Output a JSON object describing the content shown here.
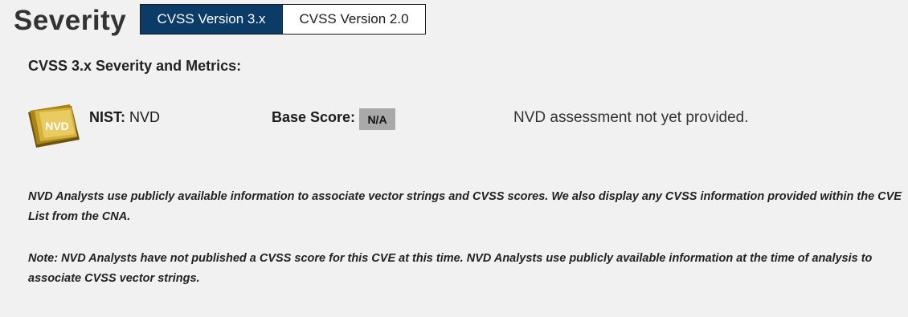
{
  "header": {
    "title": "Severity",
    "tabs": [
      {
        "label": "CVSS Version 3.x",
        "active": true
      },
      {
        "label": "CVSS Version 2.0",
        "active": false
      }
    ]
  },
  "section": {
    "heading": "CVSS 3.x Severity and Metrics:",
    "badge_text": "NVD",
    "source_label": "NIST:",
    "source_value": "NVD",
    "base_score_label": "Base Score:",
    "base_score_value": "N/A",
    "assessment": "NVD assessment not yet provided."
  },
  "notes": [
    "NVD Analysts use publicly available information to associate vector strings and CVSS scores. We also display any CVSS information provided within the CVE List from the CNA.",
    "Note: NVD Analysts have not published a CVSS score for this CVE at this time. NVD Analysts use publicly available information at the time of analysis to associate CVSS vector strings."
  ],
  "colors": {
    "active_tab_bg": "#0b3b67",
    "score_badge_bg": "#a9a9a9",
    "page_bg": "#f1f1f1",
    "nvd_badge_gold": "#c9a227"
  }
}
